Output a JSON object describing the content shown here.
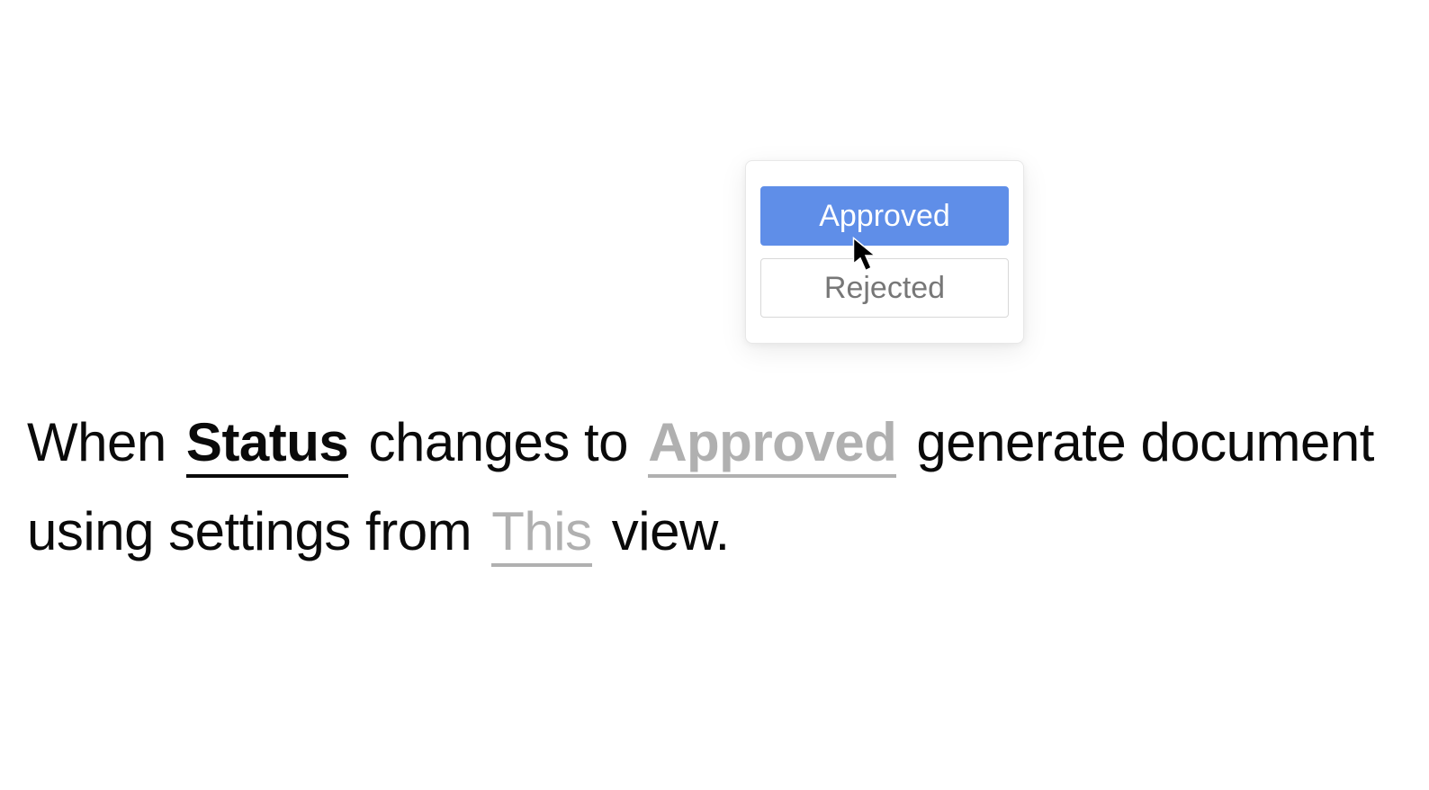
{
  "dropdown": {
    "options": [
      {
        "label": "Approved",
        "selected": true
      },
      {
        "label": "Rejected",
        "selected": false
      }
    ]
  },
  "sentence": {
    "part1": "When ",
    "field_token": "Status",
    "part2": " changes to ",
    "value_token": "Approved",
    "part3": " generate document using settings from ",
    "view_token": "This",
    "part4": " view."
  }
}
